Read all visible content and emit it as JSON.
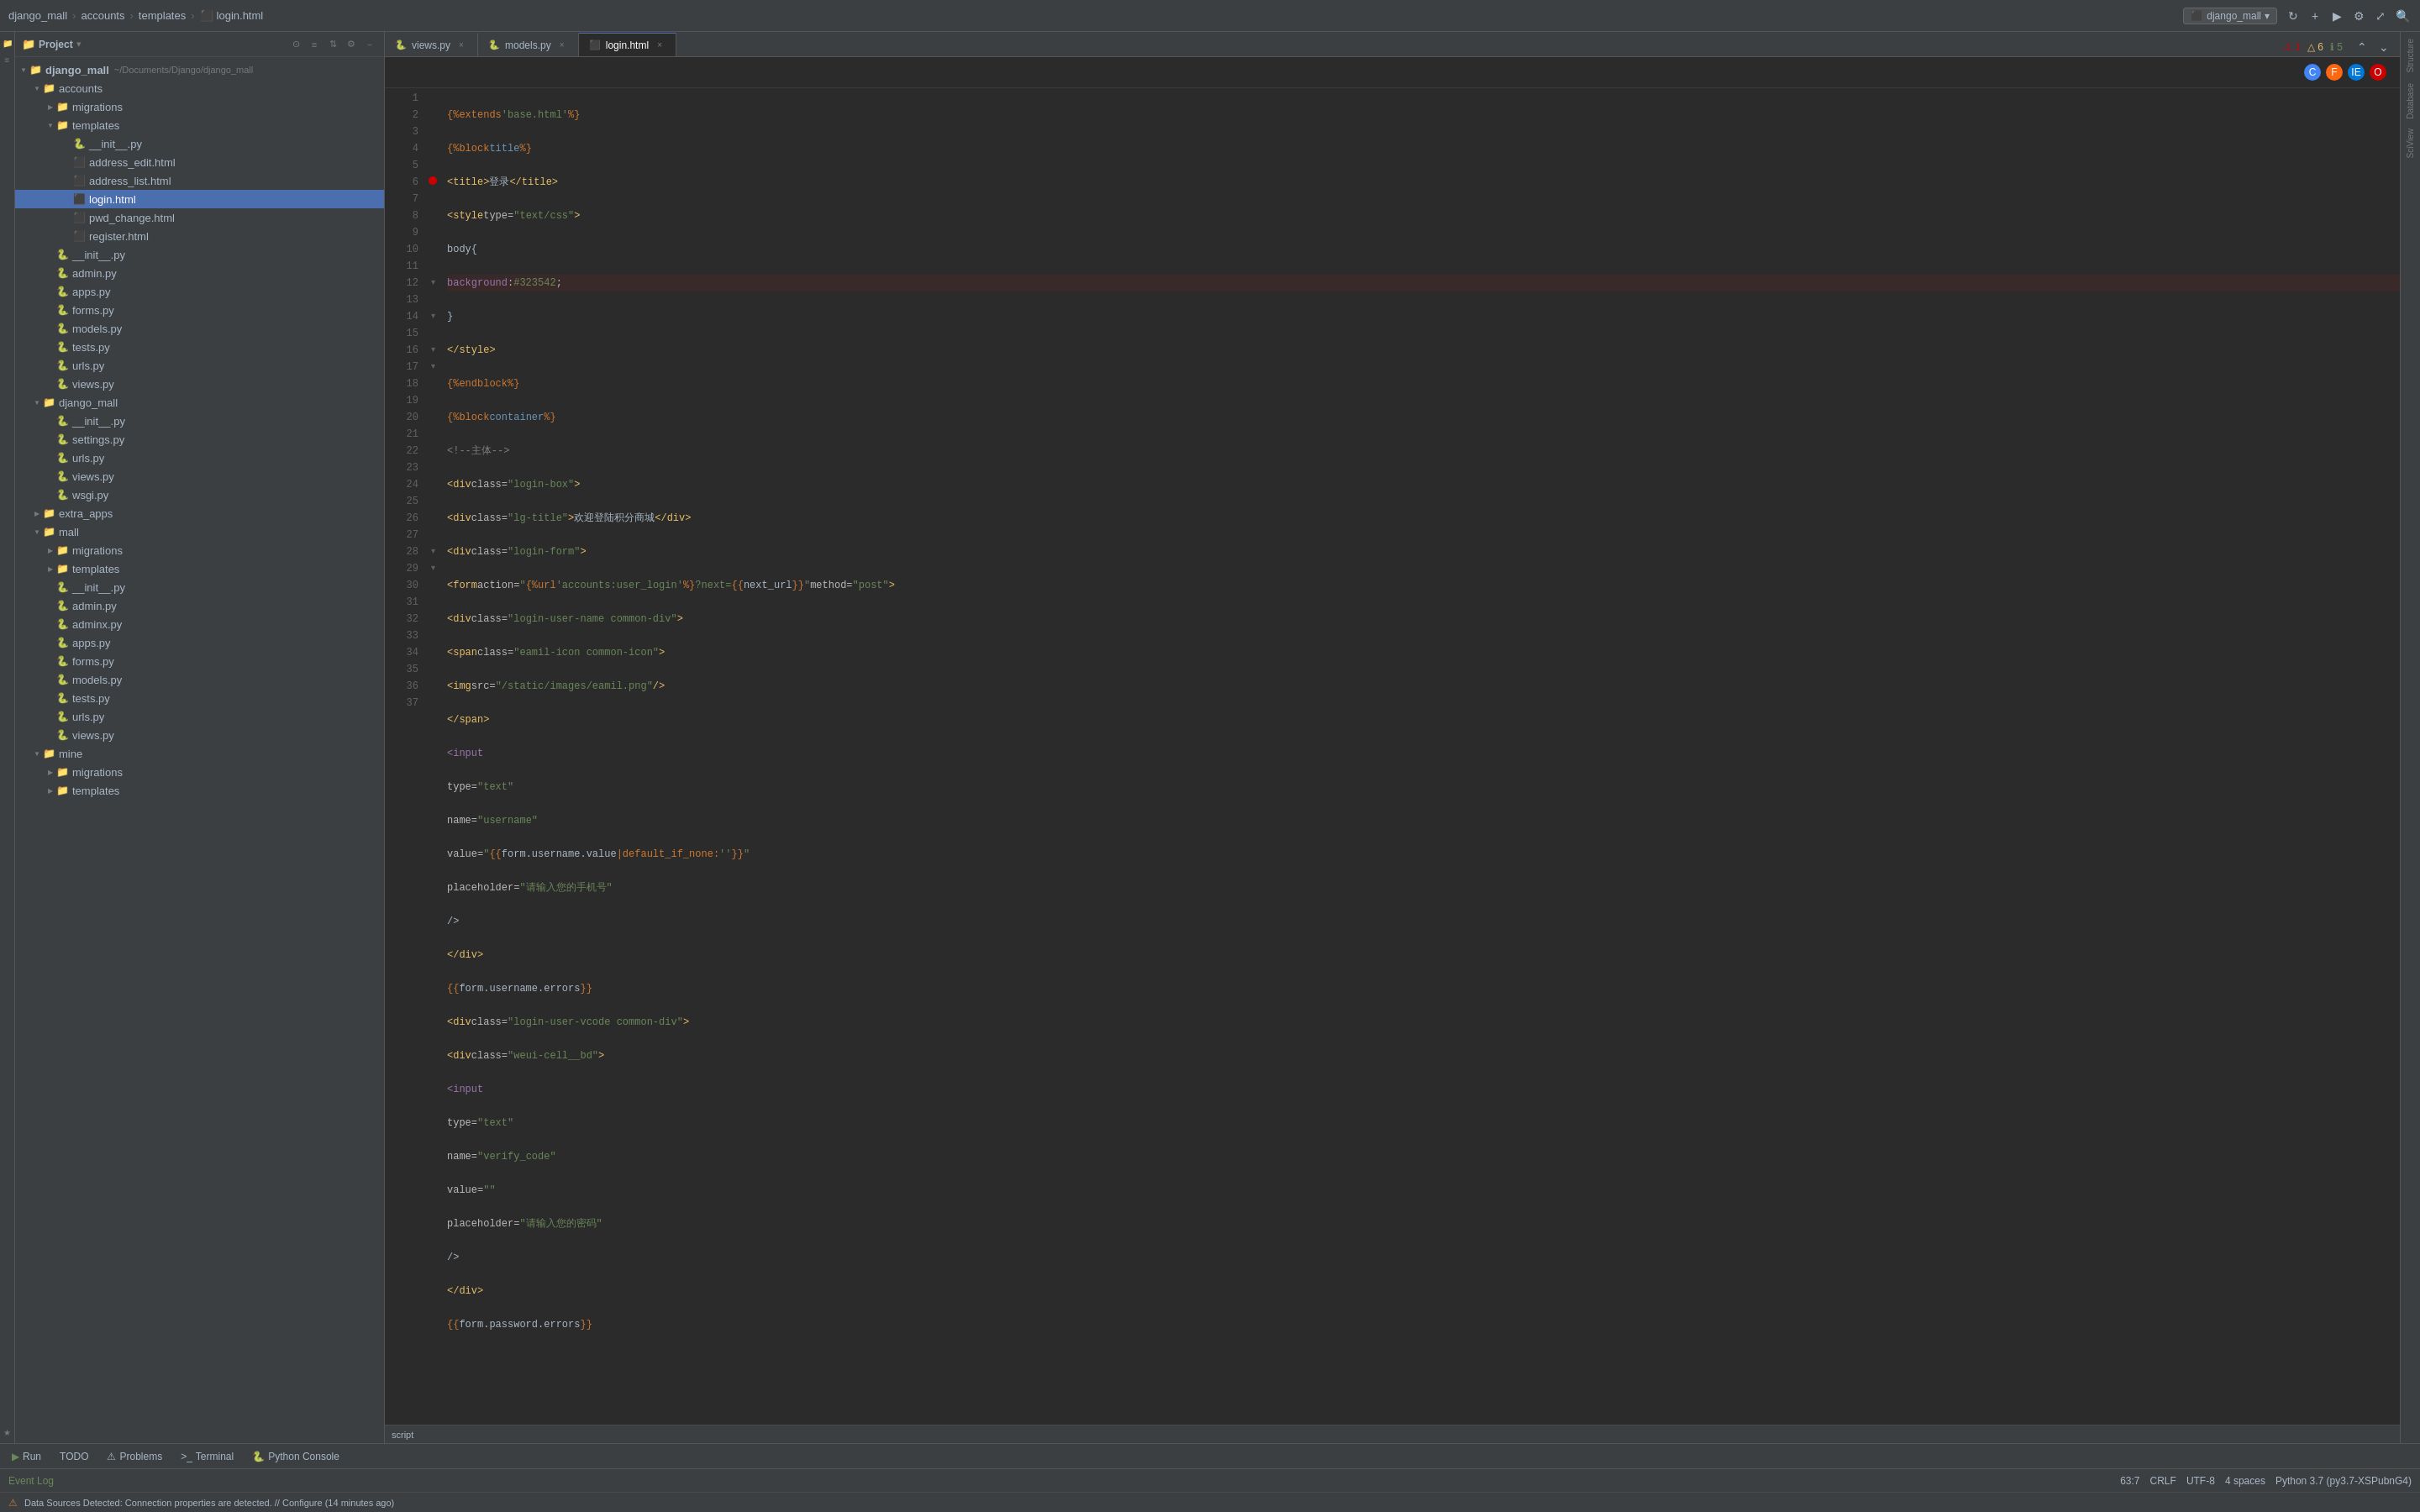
{
  "titlebar": {
    "breadcrumb": [
      "django_mall",
      "accounts",
      "templates",
      "login.html"
    ],
    "project_name": "django_mall",
    "chevron": "▾"
  },
  "toolbar": {
    "refresh_icon": "↻",
    "gear_icon": "⚙",
    "expand_icon": "⤢",
    "close_icon": "✕"
  },
  "panel": {
    "title": "Project",
    "gear_icon": "⚙",
    "layout_icon": "≡",
    "collapse_icon": "−",
    "settings_icon": "⚙",
    "close_icon": "×"
  },
  "tree": {
    "root": {
      "name": "django_mall",
      "path": "~/Documents/Django/django_mall",
      "expanded": true
    },
    "items": [
      {
        "id": "accounts",
        "label": "accounts",
        "type": "folder",
        "level": 1,
        "expanded": true
      },
      {
        "id": "migrations",
        "label": "migrations",
        "type": "folder",
        "level": 2,
        "expanded": false
      },
      {
        "id": "templates-accounts",
        "label": "templates",
        "type": "folder",
        "level": 2,
        "expanded": true
      },
      {
        "id": "init-tmpl",
        "label": "__init__.py",
        "type": "file-py",
        "level": 3
      },
      {
        "id": "address-edit",
        "label": "address_edit.html",
        "type": "file-html",
        "level": 3
      },
      {
        "id": "address-list",
        "label": "address_list.html",
        "type": "file-html",
        "level": 3
      },
      {
        "id": "login-html",
        "label": "login.html",
        "type": "file-html",
        "level": 3,
        "selected": true
      },
      {
        "id": "pwd-change",
        "label": "pwd_change.html",
        "type": "file-html",
        "level": 3
      },
      {
        "id": "register",
        "label": "register.html",
        "type": "file-html",
        "level": 3
      },
      {
        "id": "init-accounts",
        "label": "__init__.py",
        "type": "file-py",
        "level": 2
      },
      {
        "id": "admin-accounts",
        "label": "admin.py",
        "type": "file-py",
        "level": 2
      },
      {
        "id": "apps-accounts",
        "label": "apps.py",
        "type": "file-py",
        "level": 2
      },
      {
        "id": "forms-accounts",
        "label": "forms.py",
        "type": "file-py",
        "level": 2
      },
      {
        "id": "models-accounts",
        "label": "models.py",
        "type": "file-py",
        "level": 2
      },
      {
        "id": "tests-accounts",
        "label": "tests.py",
        "type": "file-py",
        "level": 2
      },
      {
        "id": "urls-accounts",
        "label": "urls.py",
        "type": "file-py",
        "level": 2
      },
      {
        "id": "views-accounts",
        "label": "views.py",
        "type": "file-py",
        "level": 2
      },
      {
        "id": "django-mall-folder",
        "label": "django_mall",
        "type": "folder",
        "level": 1,
        "expanded": true
      },
      {
        "id": "init-djmall",
        "label": "__init__.py",
        "type": "file-py",
        "level": 2
      },
      {
        "id": "settings",
        "label": "settings.py",
        "type": "file-py",
        "level": 2
      },
      {
        "id": "urls-djmall",
        "label": "urls.py",
        "type": "file-py",
        "level": 2
      },
      {
        "id": "views-djmall",
        "label": "views.py",
        "type": "file-py",
        "level": 2
      },
      {
        "id": "wsgi",
        "label": "wsgi.py",
        "type": "file-py",
        "level": 2
      },
      {
        "id": "extra-apps",
        "label": "extra_apps",
        "type": "folder",
        "level": 1,
        "expanded": false
      },
      {
        "id": "mall-folder",
        "label": "mall",
        "type": "folder",
        "level": 1,
        "expanded": true
      },
      {
        "id": "migrations-mall",
        "label": "migrations",
        "type": "folder",
        "level": 2,
        "expanded": false
      },
      {
        "id": "templates-mall",
        "label": "templates",
        "type": "folder",
        "level": 2,
        "expanded": false
      },
      {
        "id": "init-mall",
        "label": "__init__.py",
        "type": "file-py",
        "level": 2
      },
      {
        "id": "admin-mall",
        "label": "admin.py",
        "type": "file-py",
        "level": 2
      },
      {
        "id": "adminx-mall",
        "label": "adminx.py",
        "type": "file-py",
        "level": 2
      },
      {
        "id": "apps-mall",
        "label": "apps.py",
        "type": "file-py",
        "level": 2
      },
      {
        "id": "forms-mall",
        "label": "forms.py",
        "type": "file-py",
        "level": 2
      },
      {
        "id": "models-mall",
        "label": "models.py",
        "type": "file-py",
        "level": 2
      },
      {
        "id": "tests-mall",
        "label": "tests.py",
        "type": "file-py",
        "level": 2
      },
      {
        "id": "urls-mall",
        "label": "urls.py",
        "type": "file-py",
        "level": 2
      },
      {
        "id": "views-mall",
        "label": "views.py",
        "type": "file-py",
        "level": 2
      },
      {
        "id": "mine-folder",
        "label": "mine",
        "type": "folder",
        "level": 1,
        "expanded": true
      },
      {
        "id": "migrations-mine",
        "label": "migrations",
        "type": "folder",
        "level": 2,
        "expanded": false
      },
      {
        "id": "templates-mine",
        "label": "templates",
        "type": "folder",
        "level": 2,
        "expanded": false
      }
    ]
  },
  "tabs": [
    {
      "id": "views-py",
      "label": "views.py",
      "type": "py",
      "active": false,
      "modified": false
    },
    {
      "id": "models-py",
      "label": "models.py",
      "type": "py",
      "active": false,
      "modified": false
    },
    {
      "id": "login-html",
      "label": "login.html",
      "type": "html",
      "active": true,
      "modified": false
    }
  ],
  "editor": {
    "tab_errors": "1",
    "tab_warnings": "6",
    "tab_infos": "5"
  },
  "code_lines": [
    {
      "num": 1,
      "content": "{% extends 'base.html' %}",
      "fold": false,
      "breakpoint": false
    },
    {
      "num": 2,
      "content": "{% block title %}",
      "fold": false,
      "breakpoint": false
    },
    {
      "num": 3,
      "content": "    <title>登录</title>",
      "fold": false,
      "breakpoint": false
    },
    {
      "num": 4,
      "content": "    <style type=\"text/css\">",
      "fold": false,
      "breakpoint": false
    },
    {
      "num": 5,
      "content": "        body{",
      "fold": false,
      "breakpoint": false
    },
    {
      "num": 6,
      "content": "            background:#323542;",
      "fold": false,
      "breakpoint": true
    },
    {
      "num": 7,
      "content": "        }",
      "fold": false,
      "breakpoint": false
    },
    {
      "num": 8,
      "content": "    </style>",
      "fold": false,
      "breakpoint": false
    },
    {
      "num": 9,
      "content": "{% endblock %}",
      "fold": false,
      "breakpoint": false
    },
    {
      "num": 10,
      "content": "{% block container %}",
      "fold": false,
      "breakpoint": false
    },
    {
      "num": 11,
      "content": "    <!--主体-->",
      "fold": false,
      "breakpoint": false
    },
    {
      "num": 12,
      "content": "    <div class=\"login-box\">",
      "fold": true,
      "breakpoint": false
    },
    {
      "num": 13,
      "content": "        <div class=\"lg-title\">欢迎登陆积分商城</div>",
      "fold": false,
      "breakpoint": false
    },
    {
      "num": 14,
      "content": "        <div class=\"login-form\">",
      "fold": true,
      "breakpoint": false
    },
    {
      "num": 15,
      "content": "            <form action=\"{% url 'accounts:user_login' %}?next={{ next_url }}\" method=\"post\">",
      "fold": false,
      "breakpoint": false
    },
    {
      "num": 16,
      "content": "                <div class=\"login-user-name common-div\">",
      "fold": true,
      "breakpoint": false
    },
    {
      "num": 17,
      "content": "                    <span class=\"eamil-icon common-icon\">",
      "fold": true,
      "breakpoint": false
    },
    {
      "num": 18,
      "content": "                        <img src=\"/static/images/eamil.png\" />",
      "fold": false,
      "breakpoint": false
    },
    {
      "num": 19,
      "content": "                    </span>",
      "fold": false,
      "breakpoint": false
    },
    {
      "num": 20,
      "content": "                    <input",
      "fold": false,
      "breakpoint": false
    },
    {
      "num": 21,
      "content": "                        type=\"text\"",
      "fold": false,
      "breakpoint": false
    },
    {
      "num": 22,
      "content": "                        name=\"username\"",
      "fold": false,
      "breakpoint": false
    },
    {
      "num": 23,
      "content": "                        value=\"{{ form.username.value|default_if_none:'' }}\"",
      "fold": false,
      "breakpoint": false
    },
    {
      "num": 24,
      "content": "                        placeholder=\"请输入您的手机号\"",
      "fold": false,
      "breakpoint": false
    },
    {
      "num": 25,
      "content": "                    />",
      "fold": false,
      "breakpoint": false
    },
    {
      "num": 26,
      "content": "                </div>",
      "fold": false,
      "breakpoint": false
    },
    {
      "num": 27,
      "content": "                {{ form.username.errors }}",
      "fold": false,
      "breakpoint": false
    },
    {
      "num": 28,
      "content": "                <div class=\"login-user-vcode common-div\">",
      "fold": true,
      "breakpoint": false
    },
    {
      "num": 29,
      "content": "                    <div class=\"weui-cell__bd\">",
      "fold": true,
      "breakpoint": false
    },
    {
      "num": 30,
      "content": "                        <input",
      "fold": false,
      "breakpoint": false
    },
    {
      "num": 31,
      "content": "                            type=\"text\"",
      "fold": false,
      "breakpoint": false
    },
    {
      "num": 32,
      "content": "                            name=\"verify_code\"",
      "fold": false,
      "breakpoint": false
    },
    {
      "num": 33,
      "content": "                            value=\"\"",
      "fold": false,
      "breakpoint": false
    },
    {
      "num": 34,
      "content": "                            placeholder=\"请输入您的密码\"",
      "fold": false,
      "breakpoint": false
    },
    {
      "num": 35,
      "content": "                        />",
      "fold": false,
      "breakpoint": false
    },
    {
      "num": 36,
      "content": "                    </div>",
      "fold": false,
      "breakpoint": false
    },
    {
      "num": 37,
      "content": "                {{ form.password.errors }}",
      "fold": false,
      "breakpoint": false
    }
  ],
  "bottom_tabs": [
    {
      "id": "run",
      "label": "Run",
      "icon": "▶"
    },
    {
      "id": "todo",
      "label": "TODO",
      "icon": ""
    },
    {
      "id": "problems",
      "label": "Problems",
      "icon": "⚠"
    },
    {
      "id": "terminal",
      "label": "Terminal",
      "icon": ">_"
    },
    {
      "id": "python-console",
      "label": "Python Console",
      "icon": "🐍"
    }
  ],
  "status_bar": {
    "cursor": "63:7",
    "line_ending": "CRLF",
    "encoding": "UTF-8",
    "indent": "4 spaces",
    "python_version": "Python 3.7 (py3.7-XSPubnG4)",
    "event_log": "Event Log"
  },
  "notification": {
    "text": "Data Sources Detected: Connection properties are detected. // Configure (14 minutes ago)"
  },
  "right_panels": [
    {
      "id": "structure",
      "label": "Structure"
    },
    {
      "id": "database",
      "label": "Database"
    },
    {
      "id": "sciview",
      "label": "SciView"
    }
  ],
  "left_panels": [
    {
      "id": "project",
      "label": "Project"
    },
    {
      "id": "favorites",
      "label": "Favorites"
    }
  ]
}
